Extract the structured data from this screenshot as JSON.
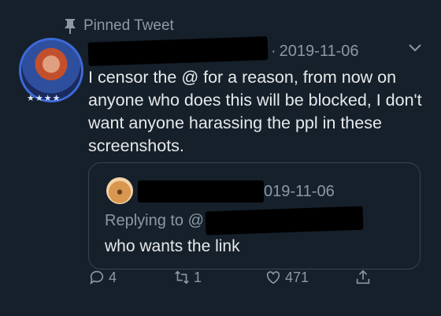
{
  "pinned": {
    "label": "Pinned Tweet"
  },
  "tweet": {
    "date": "2019-11-06",
    "text": "I censor the @ for a reason, from now on anyone who does this will be blocked, I don't want anyone harassing the ppl in these screenshots."
  },
  "quote": {
    "date_fragment": "019-11-06",
    "replying_to": "Replying to @",
    "text": "who wants the link"
  },
  "actions": {
    "replies": "4",
    "retweets": "1",
    "likes": "471"
  }
}
